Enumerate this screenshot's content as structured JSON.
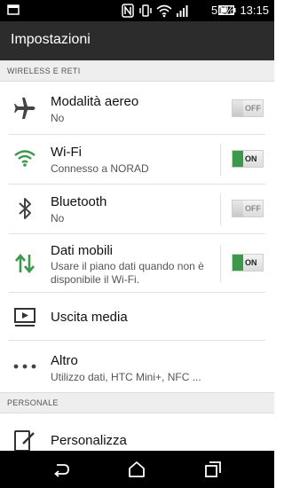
{
  "status_bar": {
    "battery_percent": "51%",
    "time": "13:15"
  },
  "app_bar": {
    "title": "Impostazioni"
  },
  "sections": {
    "wireless": "WIRELESS E RETI",
    "personal": "PERSONALE"
  },
  "rows": {
    "airplane": {
      "title": "Modalità aereo",
      "subtitle": "No",
      "toggle": "OFF"
    },
    "wifi": {
      "title": "Wi-Fi",
      "subtitle": "Connesso a NORAD",
      "toggle": "ON"
    },
    "bluetooth": {
      "title": "Bluetooth",
      "subtitle": "No",
      "toggle": "OFF"
    },
    "mobile_data": {
      "title": "Dati mobili",
      "subtitle_line1": "Usare il piano dati quando non è",
      "subtitle_line2": "disponibile il Wi-Fi.",
      "toggle": "ON"
    },
    "media_output": {
      "title": "Uscita media"
    },
    "more": {
      "title": "Altro",
      "subtitle": "Utilizzo dati, HTC Mini+, NFC ..."
    },
    "personalize": {
      "title": "Personalizza"
    }
  },
  "colors": {
    "accent_green": "#3a9a4a",
    "app_bar": "#2c2c2c"
  },
  "icons": [
    "nfc-icon",
    "vibrate-icon",
    "wifi-status-icon",
    "signal-icon",
    "battery-icon",
    "airplane-icon",
    "wifi-icon",
    "bluetooth-icon",
    "mobile-data-icon",
    "media-output-icon",
    "more-icon",
    "personalize-icon",
    "back-icon",
    "home-icon",
    "recents-icon"
  ]
}
